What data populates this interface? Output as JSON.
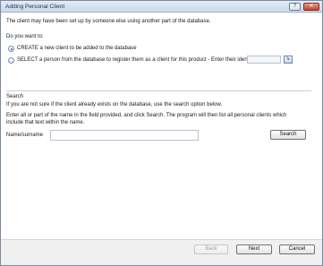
{
  "window": {
    "title": "Adding Personal Client",
    "help_button": "?",
    "close_button": "✕"
  },
  "intro": "The client may have been set up by someone else using another part of the database.",
  "question": "Do you want to:",
  "options": [
    {
      "label": "CREATE a new client to be added to the database",
      "selected": true
    },
    {
      "label": "SELECT a person from the database to register them as a client for this product - Enter their identifier",
      "selected": false
    }
  ],
  "identifier": {
    "value": "",
    "button_icon": "lookup-icon"
  },
  "search": {
    "heading": "Search",
    "line1": "If you are not sure if the client already exists on the database, use the search option below.",
    "line2": "Enter all or part of the name in the field provided, and click Search. The program will then list all personal clients which",
    "line3": "include that text within the name.",
    "name_label": "Name/surname",
    "name_value": "",
    "button": "Search"
  },
  "footer": {
    "back": "Back",
    "next": "Next",
    "cancel": "Cancel"
  }
}
